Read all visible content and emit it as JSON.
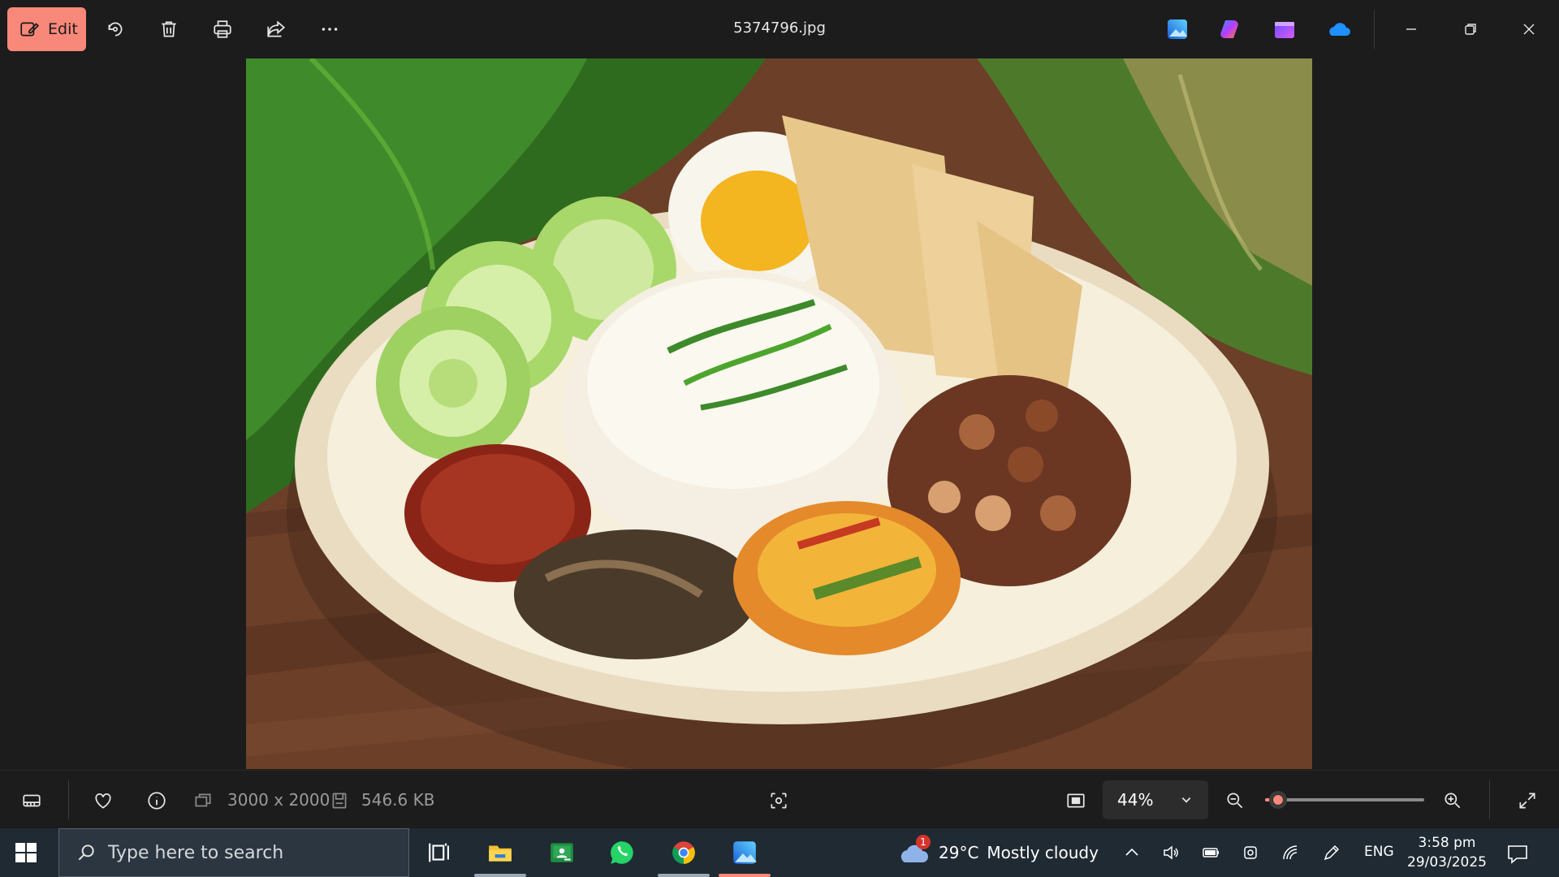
{
  "window": {
    "title": "5374796.jpg"
  },
  "toolbar": {
    "edit_label": "Edit",
    "icons": [
      "edit-image-icon",
      "rotate-icon",
      "delete-icon",
      "print-icon",
      "share-icon",
      "more-icon"
    ]
  },
  "pinned_apps": [
    "photos-app-icon",
    "copilot-app-icon",
    "clipchamp-app-icon",
    "onedrive-app-icon"
  ],
  "bottom_bar": {
    "dimensions": "3000 x 2000",
    "file_size": "546.6 KB",
    "zoom_label": "44%",
    "zoom_level_percent": 44,
    "slider_fraction": 0.08
  },
  "taskbar": {
    "search_placeholder": "Type here to search",
    "weather_badge": "1",
    "temperature": "29°C",
    "condition": "Mostly cloudy",
    "language": "ENG",
    "time": "3:58 pm",
    "date": "29/03/2025"
  },
  "colors": {
    "accent": "#f8887a",
    "background": "#1c1c1c",
    "taskbar": "#1f2a33"
  }
}
